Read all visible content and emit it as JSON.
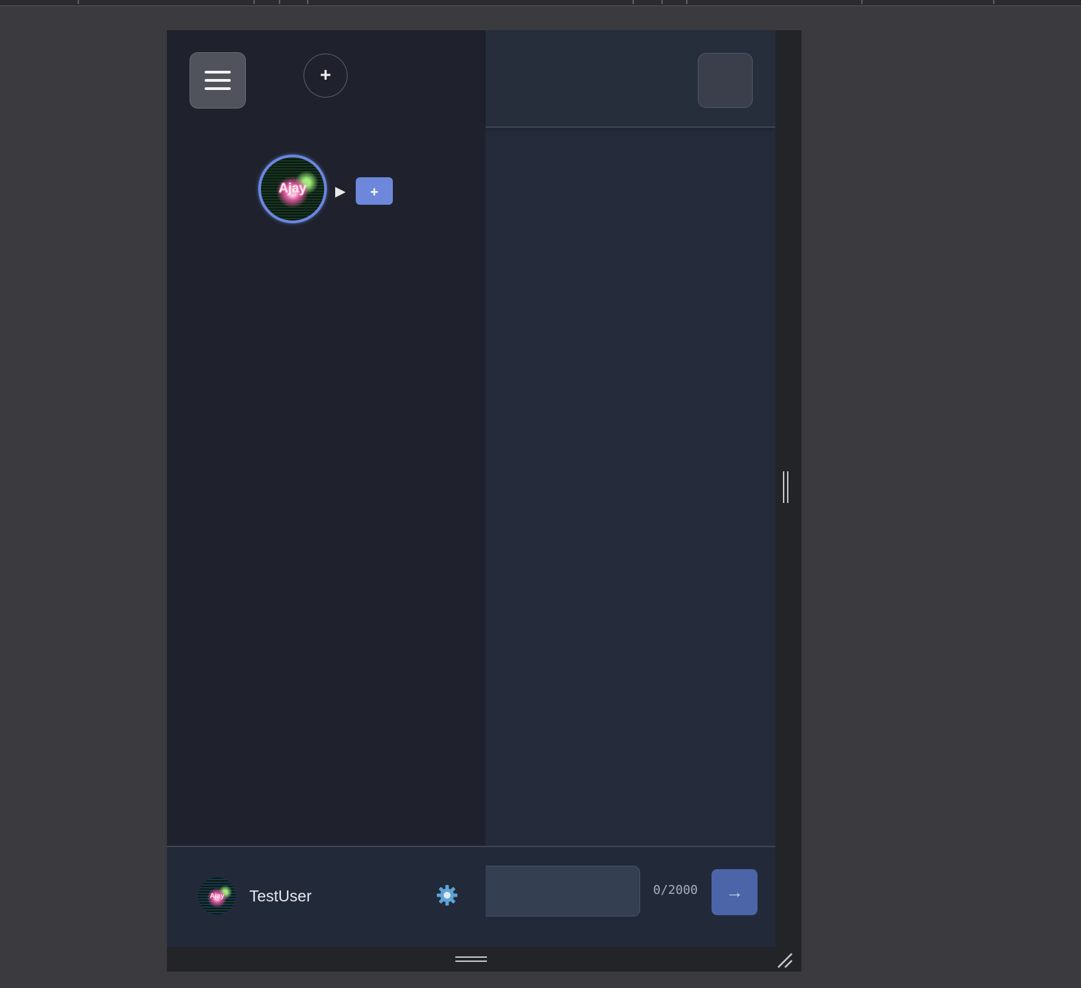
{
  "colors": {
    "page_background": "#3b3a3f",
    "sidebar_background": "#1f222c",
    "chat_background": "#252b3a",
    "panel_background": "#222a3a",
    "accent": "#6d88da",
    "send_button": "#4c64a8",
    "active_ring": "#6a86e0"
  },
  "icons": {
    "menu": "hamburger-icon",
    "new_server": "plus-icon",
    "expand": "play-triangle-icon",
    "add_channel": "plus-icon",
    "settings": "gear-icon",
    "send": "arrow-right-icon",
    "side_handle": "vertical-grip-icon",
    "bottom_handle": "horizontal-grip-icon",
    "corner": "resize-corner-icon"
  },
  "sidebar": {
    "new_server_glyph": "+",
    "server": {
      "avatar_text": "Ajay",
      "expand_glyph": "▶",
      "add_channel_glyph": "+"
    }
  },
  "user": {
    "avatar_text": "Ajay",
    "name": "TestUser"
  },
  "composer": {
    "char_count": "0/2000",
    "send_glyph": "→"
  }
}
